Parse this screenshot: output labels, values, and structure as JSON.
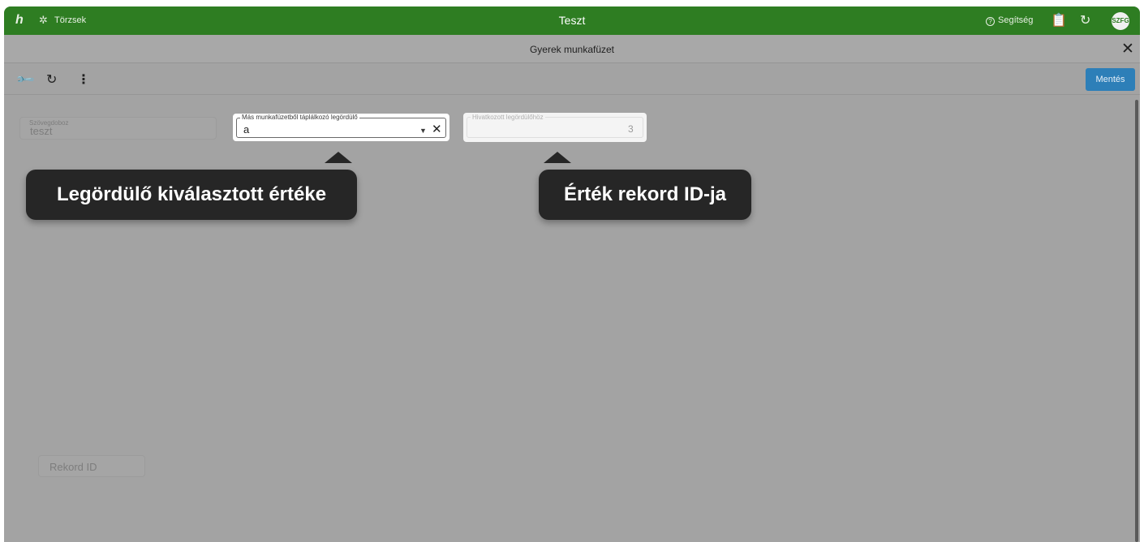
{
  "appbar": {
    "logo": "h",
    "breadcrumb_icon": "grid-icon",
    "breadcrumb_label": "Törzsek",
    "title": "Teszt",
    "help_label": "Segítség",
    "avatar_initials": "SZFG"
  },
  "dialog": {
    "title": "Gyerek munkafüzet",
    "close_icon": "close-icon"
  },
  "toolbar": {
    "save_label": "Mentés"
  },
  "fields": {
    "textbox": {
      "label": "Szövegdoboz",
      "value": "teszt"
    },
    "dropdown": {
      "label": "Más munkafüzetből táplálkozó legördülő",
      "value": "a"
    },
    "reference": {
      "label": "Hivatkozott legördülőhöz",
      "value": "3"
    },
    "rekord_id": {
      "placeholder": "Rekord ID"
    }
  },
  "callouts": {
    "left": "Legördülő kiválasztott értéke",
    "right": "Érték rekord ID-ja"
  },
  "colors": {
    "appbar": "#2e7d22",
    "accent": "#2d7fb8",
    "overlay": "#a3a3a3",
    "callout_bg": "#262626"
  }
}
